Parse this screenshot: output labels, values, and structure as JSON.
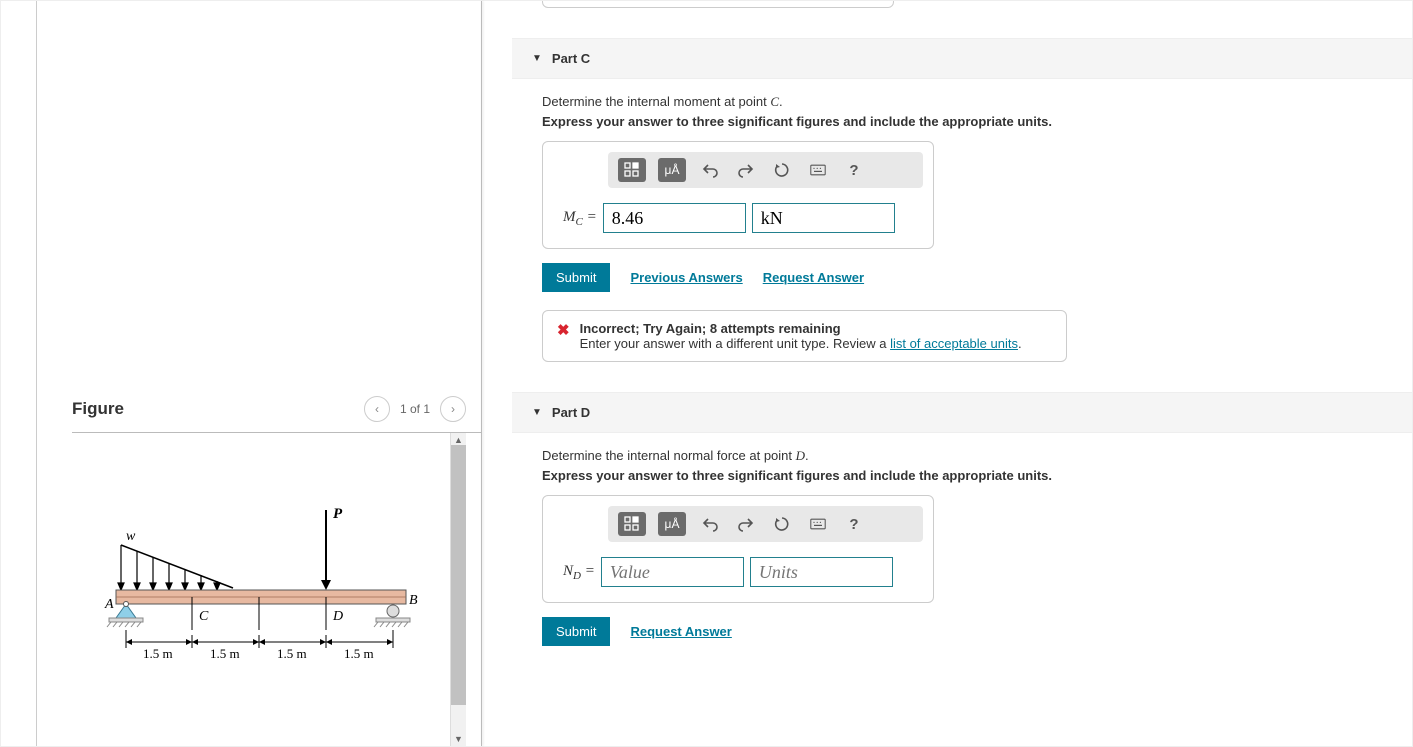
{
  "figure": {
    "title": "Figure",
    "pager": "1 of 1",
    "labels": {
      "P": "P",
      "w": "w",
      "A": "A",
      "B": "B",
      "C": "C",
      "D": "D",
      "dim": "1.5 m"
    }
  },
  "partC": {
    "header": "Part C",
    "prompt_html": "Determine the internal moment at point ",
    "point": "C",
    "instruction": "Express your answer to three significant figures and include the appropriate units.",
    "var_main": "M",
    "var_sub": "C",
    "equals": " =",
    "value": "8.46",
    "units": "kN",
    "submit": "Submit",
    "prev": "Previous Answers",
    "req": "Request Answer",
    "feedback_title": "Incorrect; Try Again; 8 attempts remaining",
    "feedback_msg_pre": "Enter your answer with a different unit type. Review a ",
    "feedback_link": "list of acceptable units",
    "feedback_msg_post": "."
  },
  "partD": {
    "header": "Part D",
    "prompt_html": "Determine the internal normal force at point ",
    "point": "D",
    "instruction": "Express your answer to three significant figures and include the appropriate units.",
    "var_main": "N",
    "var_sub": "D",
    "equals": " =",
    "value_ph": "Value",
    "units_ph": "Units",
    "submit": "Submit",
    "req": "Request Answer"
  },
  "toolbar": {
    "units_label": "μÅ"
  }
}
